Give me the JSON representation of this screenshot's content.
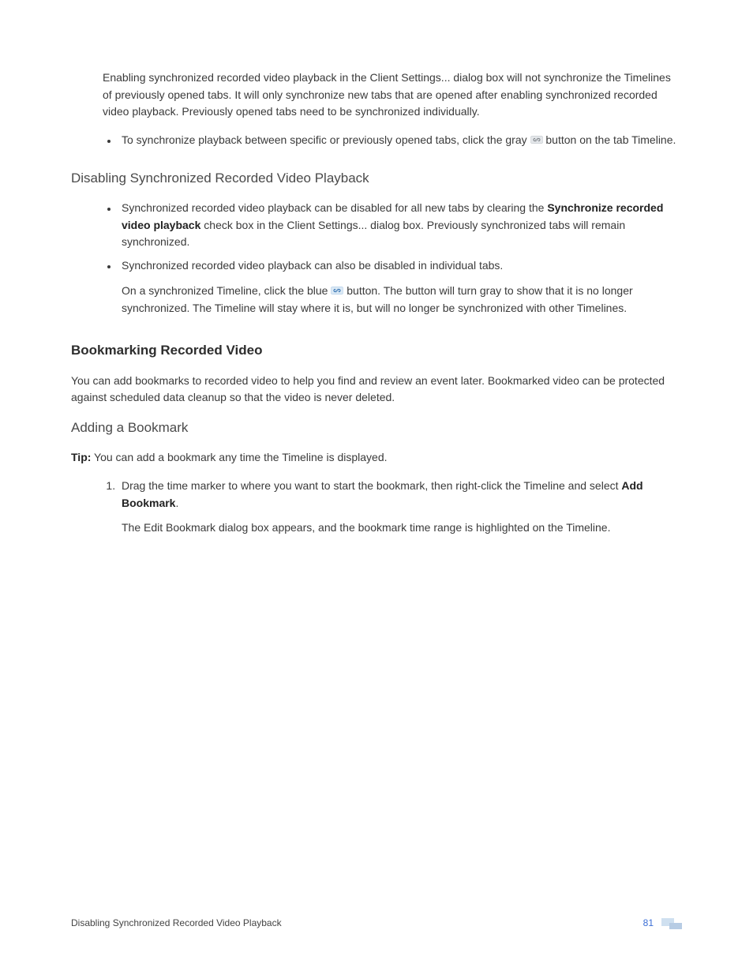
{
  "intro_para": "Enabling synchronized recorded video playback in the Client Settings... dialog box will not synchronize the Timelines of previously opened tabs. It will only synchronize new tabs that are opened after enabling synchronized recorded video playback. Previously opened tabs need to be synchronized individually.",
  "intro_bullet_1_pre": "To synchronize playback between specific or previously opened tabs, click the gray ",
  "intro_bullet_1_post": " button on the tab Timeline.",
  "section_disable_title": "Disabling Synchronized Recorded Video Playback",
  "disable_b1_pre": "Synchronized recorded video playback can be disabled for all new tabs by clearing the ",
  "disable_b1_bold": "Synchronize recorded video playback",
  "disable_b1_post": " check box in the Client Settings... dialog box. Previously synchronized tabs will remain synchronized.",
  "disable_b2": "Synchronized recorded video playback can also be disabled in individual tabs.",
  "disable_b2_para_pre": "On a synchronized Timeline, click the blue ",
  "disable_b2_para_post": " button. The button will turn gray to show that it is no longer synchronized. The Timeline will stay where it is, but will no longer be synchronized with other Timelines.",
  "section_bookmark_title": "Bookmarking Recorded Video",
  "bookmark_intro": "You can add bookmarks to recorded video to help you find and review an event later. Bookmarked video can be protected against scheduled data cleanup so that the video is never deleted.",
  "section_add_bookmark_title": "Adding a Bookmark",
  "tip_label": "Tip:",
  "tip_text": " You can add a bookmark any time the Timeline is displayed.",
  "step1_pre": "Drag the time marker to where you want to start the bookmark, then right-click the Timeline and select ",
  "step1_bold": "Add Bookmark",
  "step1_post": ".",
  "step1_result": "The Edit Bookmark dialog box appears, and the bookmark time range is highlighted on the Timeline.",
  "footer_title": "Disabling Synchronized Recorded Video Playback",
  "page_number": "81",
  "icon_gray_color": "#8a8f94",
  "icon_blue_color": "#2f6fb0"
}
